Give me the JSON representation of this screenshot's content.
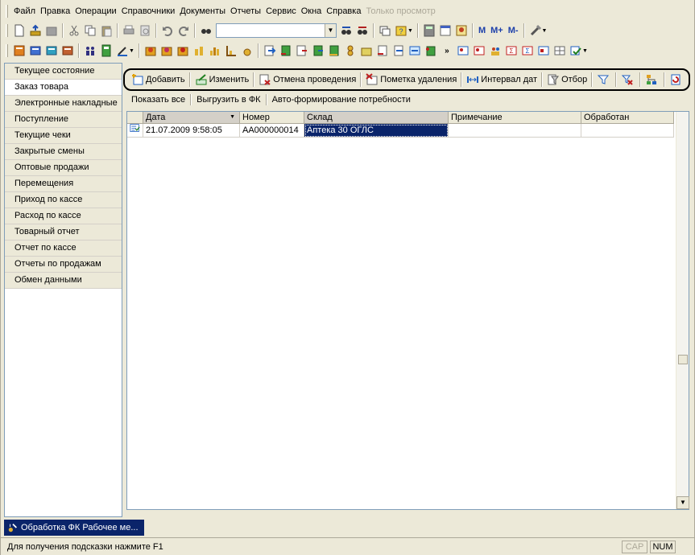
{
  "menubar": {
    "items": [
      "Файл",
      "Правка",
      "Операции",
      "Справочники",
      "Документы",
      "Отчеты",
      "Сервис",
      "Окна",
      "Справка"
    ],
    "mode_label": "Только просмотр"
  },
  "toolbar": {
    "search_value": "",
    "memory_buttons": [
      "M",
      "M+",
      "M-"
    ]
  },
  "sidebar": {
    "items": [
      "Текущее состояние",
      "Заказ товара",
      "Электронные накладные",
      "Поступление",
      "Текущие чеки",
      "Закрытые смены",
      "Оптовые продажи",
      "Перемещения",
      "Приход по кассе",
      "Расход по кассе",
      "Товарный отчет",
      "Отчет по кассе",
      "Отчеты по продажам",
      "Обмен данными"
    ],
    "active_index": 1
  },
  "actions": {
    "add": "Добавить",
    "edit": "Изменить",
    "cancel_posting": "Отмена проведения",
    "mark_delete": "Пометка удаления",
    "date_interval": "Интервал дат",
    "filter": "Отбор"
  },
  "links": {
    "show_all": "Показать все",
    "export_fk": "Выгрузить в ФК",
    "auto_form": "Авто-формирование потребности"
  },
  "table": {
    "columns": [
      "Дата",
      "Номер",
      "Склад",
      "Примечание",
      "Обработан"
    ],
    "rows": [
      {
        "date": "21.07.2009 9:58:05",
        "number": "АА000000014",
        "warehouse": "Аптека 30 ОГЛС",
        "note": "",
        "processed": ""
      }
    ]
  },
  "window_tab": {
    "label": "Обработка  ФК Рабочее ме..."
  },
  "status": {
    "hint": "Для получения подсказки нажмите F1",
    "cap": "CAP",
    "num": "NUM"
  },
  "colors": {
    "selection": "#0a246a",
    "chrome": "#ece9d8",
    "border": "#7f9db9"
  }
}
